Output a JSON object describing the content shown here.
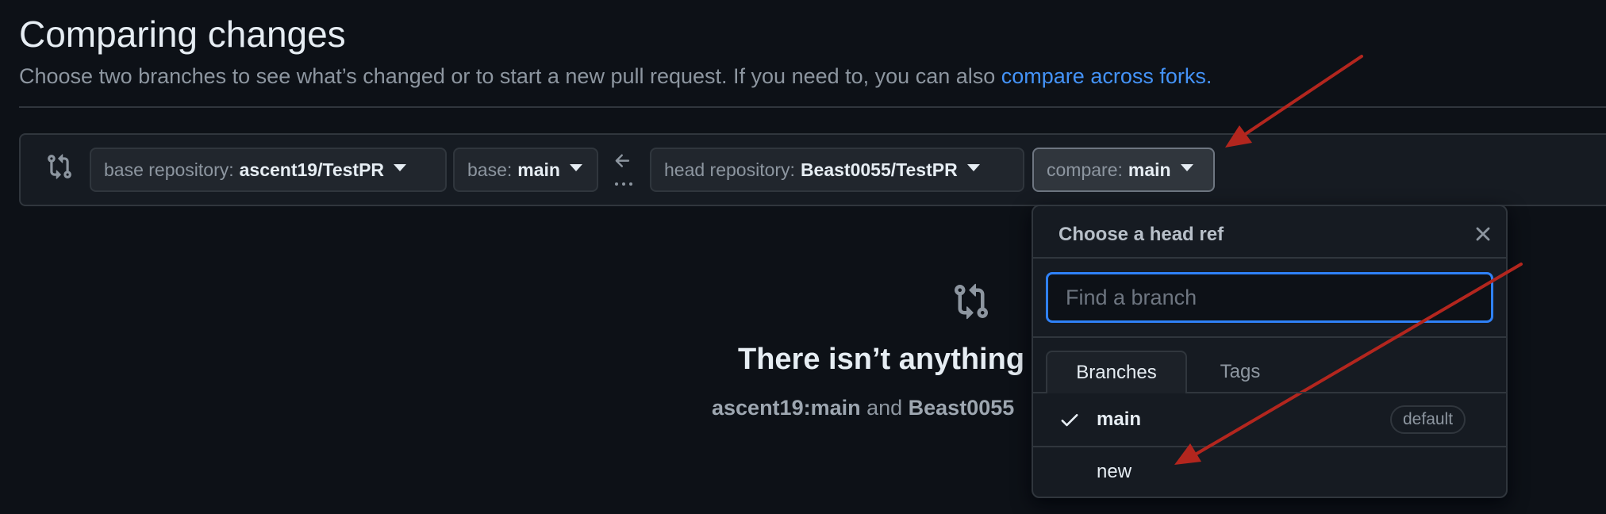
{
  "header": {
    "title": "Comparing changes",
    "subtitle": "Choose two branches to see what’s changed or to start a new pull request. If you need to, you can also ",
    "subtitle_link": "compare across forks."
  },
  "toolbar": {
    "base_repo_label": "base repository:",
    "base_repo_value": "ascent19/TestPR",
    "base_label": "base:",
    "base_value": "main",
    "head_repo_label": "head repository:",
    "head_repo_value": "Beast0055/TestPR",
    "compare_label": "compare:",
    "compare_value": "main"
  },
  "blankslate": {
    "title": "There isn’t anything",
    "desc_from": "ascent19:main",
    "desc_and": " and ",
    "desc_to": "Beast0055"
  },
  "dropdown": {
    "title": "Choose a head ref",
    "filter_placeholder": "Find a branch",
    "tabs": [
      "Branches",
      "Tags"
    ],
    "items": [
      {
        "label": "main",
        "badge": "default",
        "selected": true
      },
      {
        "label": "new"
      }
    ]
  },
  "colors": {
    "background": "#0d1117",
    "link": "#4493f8",
    "focus_ring": "#2f81f7",
    "annotation_arrow": "#b3261e"
  },
  "icons": [
    "git-compare-icon",
    "arrow-left-icon",
    "kebab-horizontal-icon",
    "close-icon",
    "check-icon"
  ]
}
